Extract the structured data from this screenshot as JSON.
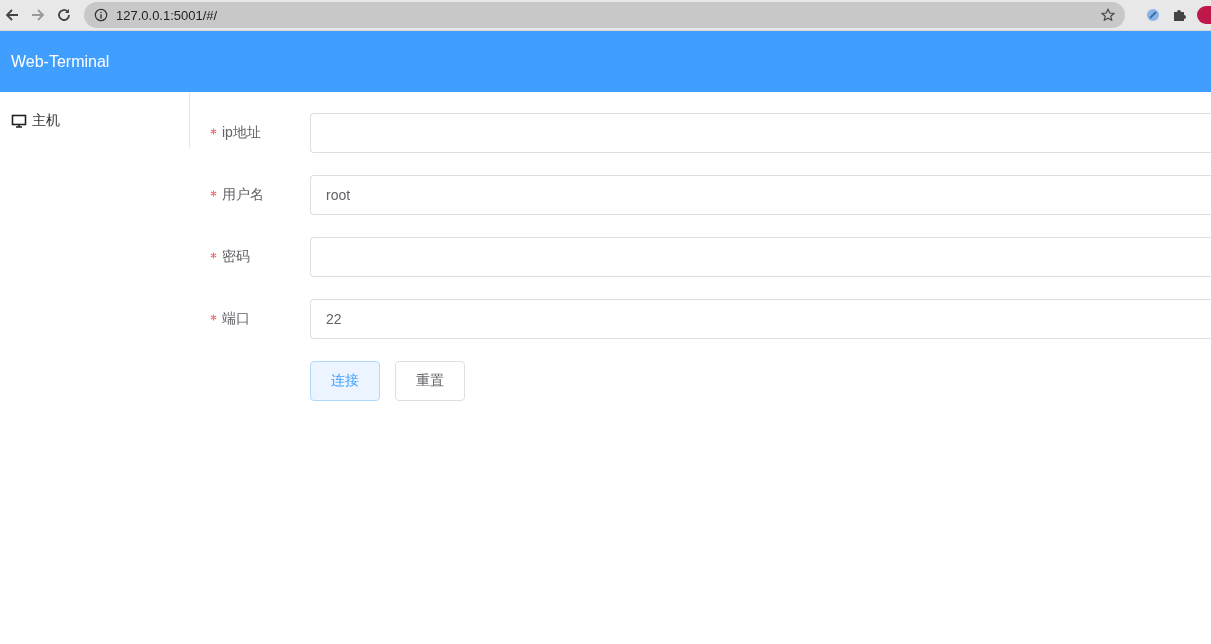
{
  "browser": {
    "url": "127.0.0.1:5001/#/"
  },
  "header": {
    "title": "Web-Terminal"
  },
  "sidebar": {
    "items": [
      {
        "label": "主机",
        "selected": false
      }
    ]
  },
  "form": {
    "fields": [
      {
        "label": "ip地址",
        "required": true
      },
      {
        "label": "用户名",
        "required": true,
        "value": "root"
      },
      {
        "label": "密码",
        "required": true
      },
      {
        "label": "端口",
        "required": true,
        "value": "22"
      }
    ],
    "buttons": [
      {
        "label": "连接",
        "kind": "primary"
      },
      {
        "label": "重置",
        "kind": "default"
      }
    ]
  }
}
